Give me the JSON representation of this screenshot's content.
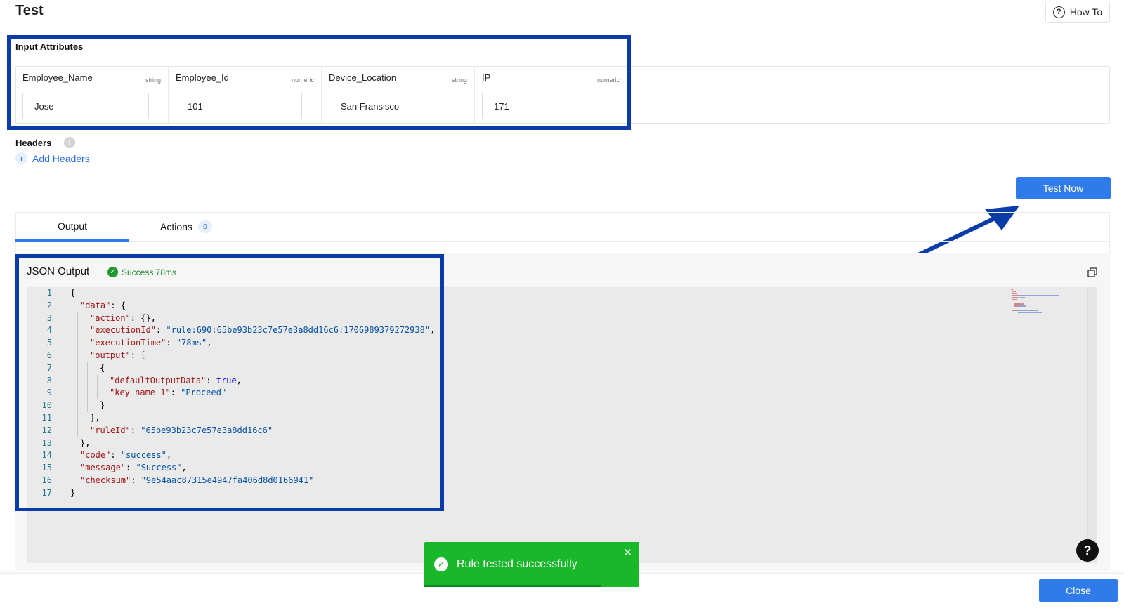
{
  "header": {
    "title": "Test",
    "how_to_label": "How To"
  },
  "input_attributes": {
    "title": "Input Attributes",
    "fields": [
      {
        "name": "Employee_Name",
        "type": "string",
        "value": "Jose"
      },
      {
        "name": "Employee_Id",
        "type": "numeric",
        "value": "101"
      },
      {
        "name": "Device_Location",
        "type": "string",
        "value": "San Fransisco"
      },
      {
        "name": "IP",
        "type": "numeric",
        "value": "171"
      }
    ]
  },
  "headers": {
    "label": "Headers",
    "add_label": "Add Headers"
  },
  "actions": {
    "test_now": "Test Now",
    "close": "Close"
  },
  "tabs": {
    "output": "Output",
    "actions": "Actions",
    "actions_count": "0"
  },
  "json_output": {
    "title": "JSON Output",
    "status": "Success 78ms",
    "lines": [
      {
        "n": "1",
        "indent": 0,
        "tokens": [
          [
            "p",
            "{"
          ]
        ]
      },
      {
        "n": "2",
        "indent": 1,
        "tokens": [
          [
            "k",
            "\"data\""
          ],
          [
            "p",
            ": {"
          ]
        ]
      },
      {
        "n": "3",
        "indent": 2,
        "tokens": [
          [
            "k",
            "\"action\""
          ],
          [
            "p",
            ": {},"
          ]
        ]
      },
      {
        "n": "4",
        "indent": 2,
        "tokens": [
          [
            "k",
            "\"executionId\""
          ],
          [
            "p",
            ": "
          ],
          [
            "s",
            "\"rule:690:65be93b23c7e57e3a8dd16c6:1706989379272938\""
          ],
          [
            "p",
            ","
          ]
        ]
      },
      {
        "n": "5",
        "indent": 2,
        "tokens": [
          [
            "k",
            "\"executionTime\""
          ],
          [
            "p",
            ": "
          ],
          [
            "s",
            "\"78ms\""
          ],
          [
            "p",
            ","
          ]
        ]
      },
      {
        "n": "6",
        "indent": 2,
        "tokens": [
          [
            "k",
            "\"output\""
          ],
          [
            "p",
            ": ["
          ]
        ]
      },
      {
        "n": "7",
        "indent": 3,
        "tokens": [
          [
            "p",
            "{"
          ]
        ]
      },
      {
        "n": "8",
        "indent": 4,
        "tokens": [
          [
            "k",
            "\"defaultOutputData\""
          ],
          [
            "p",
            ": "
          ],
          [
            "b",
            "true"
          ],
          [
            "p",
            ","
          ]
        ]
      },
      {
        "n": "9",
        "indent": 4,
        "tokens": [
          [
            "k",
            "\"key_name_1\""
          ],
          [
            "p",
            ": "
          ],
          [
            "s",
            "\"Proceed\""
          ]
        ]
      },
      {
        "n": "10",
        "indent": 3,
        "tokens": [
          [
            "p",
            "}"
          ]
        ]
      },
      {
        "n": "11",
        "indent": 2,
        "tokens": [
          [
            "p",
            "],"
          ]
        ]
      },
      {
        "n": "12",
        "indent": 2,
        "tokens": [
          [
            "k",
            "\"ruleId\""
          ],
          [
            "p",
            ": "
          ],
          [
            "s",
            "\"65be93b23c7e57e3a8dd16c6\""
          ]
        ]
      },
      {
        "n": "13",
        "indent": 1,
        "tokens": [
          [
            "p",
            "},"
          ]
        ]
      },
      {
        "n": "14",
        "indent": 1,
        "tokens": [
          [
            "k",
            "\"code\""
          ],
          [
            "p",
            ": "
          ],
          [
            "s",
            "\"success\""
          ],
          [
            "p",
            ","
          ]
        ]
      },
      {
        "n": "15",
        "indent": 1,
        "tokens": [
          [
            "k",
            "\"message\""
          ],
          [
            "p",
            ": "
          ],
          [
            "s",
            "\"Success\""
          ],
          [
            "p",
            ","
          ]
        ]
      },
      {
        "n": "16",
        "indent": 1,
        "tokens": [
          [
            "k",
            "\"checksum\""
          ],
          [
            "p",
            ": "
          ],
          [
            "s",
            "\"9e54aac87315e4947fa406d8d0166941\""
          ]
        ]
      },
      {
        "n": "17",
        "indent": 0,
        "tokens": [
          [
            "p",
            "}"
          ]
        ]
      }
    ]
  },
  "toast": {
    "message": "Rule tested successfully",
    "progress": 0.82
  },
  "colors": {
    "accent": "#2f7bea",
    "highlight_border": "#0a3ca8",
    "success": "#18b82a",
    "annotation_arrow": "#0a3ca8"
  },
  "icons": [
    "question-circle-icon",
    "info-icon",
    "plus-icon",
    "check-circle-icon",
    "copy-icon",
    "close-icon",
    "help-icon",
    "arrow-annotation"
  ]
}
